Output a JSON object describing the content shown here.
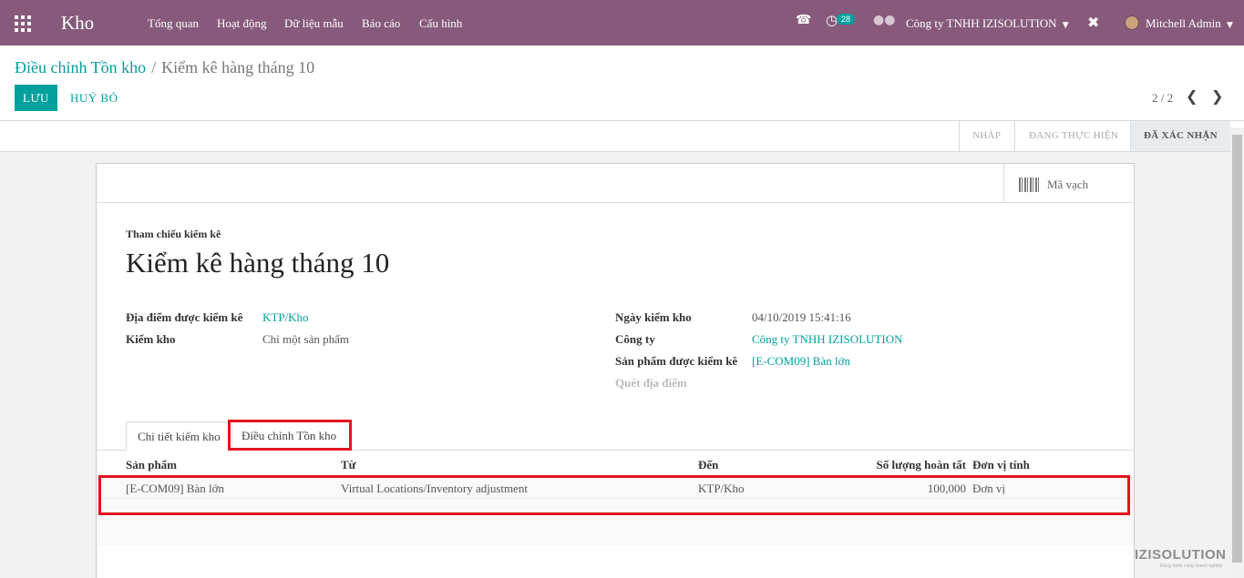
{
  "navbar": {
    "app_title": "Kho",
    "menu": [
      "Tổng quan",
      "Hoạt động",
      "Dữ liệu mẫu",
      "Báo cáo",
      "Cấu hình"
    ],
    "phone_icon": "phone-icon",
    "activity_badge": "28",
    "company": "Công ty TNHH IZISOLUTION",
    "user": "Mitchell Admin"
  },
  "breadcrumb": {
    "parent": "Điều chỉnh Tồn kho",
    "current": "Kiểm kê hàng tháng 10"
  },
  "actions": {
    "save": "LƯU",
    "discard": "HUỶ BỎ"
  },
  "pager": {
    "value": "2 / 2"
  },
  "status": {
    "stages": [
      "NHÁP",
      "ĐANG THỰC HIỆN",
      "ĐÃ XÁC NHẬN"
    ],
    "active": "ĐÃ XÁC NHẬN"
  },
  "button_box": {
    "barcode": "Mã vạch"
  },
  "form": {
    "ref_label": "Tham chiếu kiểm kê",
    "name": "Kiểm kê hàng tháng 10",
    "left": [
      {
        "label": "Địa điểm được kiểm kê",
        "value": "KTP/Kho"
      },
      {
        "label": "Kiểm kho",
        "value": "Chỉ một sản phẩm"
      }
    ],
    "right": [
      {
        "label": "Ngày kiểm kho",
        "value": "04/10/2019 15:41:16"
      },
      {
        "label": "Công ty",
        "value": "Công ty TNHH IZISOLUTION"
      },
      {
        "label": "Sản phẩm được kiểm kê",
        "value": "[E-COM09] Bàn lớn"
      },
      {
        "label": "Quét địa điểm",
        "value": ""
      }
    ]
  },
  "tabs": [
    "Chi tiết kiểm kho",
    "Điều chỉnh Tồn kho"
  ],
  "table": {
    "headers": [
      "Sản phẩm",
      "Từ",
      "Đến",
      "Số lượng hoàn tất",
      "Đơn vị tính"
    ],
    "rows": [
      [
        "[E-COM09] Bàn lớn",
        "Virtual Locations/Inventory adjustment",
        "KTP/Kho",
        "100,000",
        "Đơn vị"
      ]
    ]
  },
  "watermark": {
    "text": "IZISOLUTION",
    "sub": "Đồng hành cùng doanh nghiệp"
  },
  "colors": {
    "navbar": "#875a7b",
    "accent": "#00a09d",
    "highlight": "#e2141f"
  }
}
